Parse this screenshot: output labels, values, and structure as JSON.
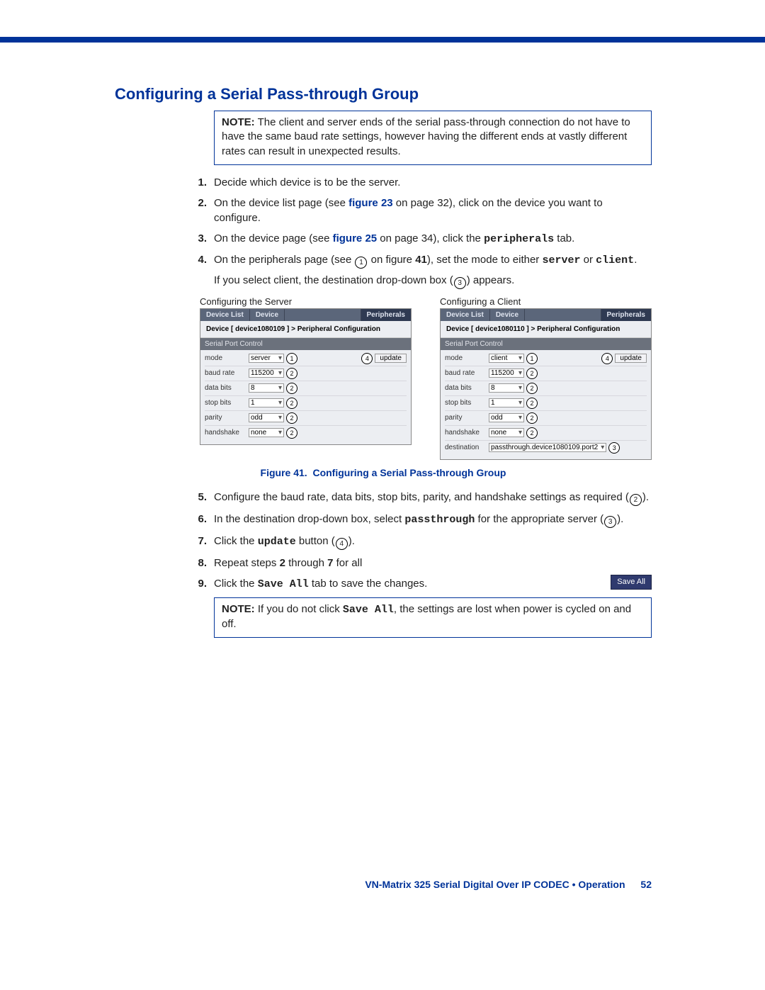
{
  "header": {
    "title": "Configuring a Serial Pass-through Group"
  },
  "note1": {
    "label": "NOTE:",
    "text": "The client and server ends of the serial pass-through connection do not have to have the same baud rate settings, however having the different ends at vastly different rates can result in unexpected results."
  },
  "steps": {
    "s1": {
      "n": "1.",
      "t": "Decide which device is to be the server."
    },
    "s2": {
      "n": "2.",
      "pre": "On the device list page (see ",
      "figref": "figure 23",
      "mid": " on page 32), click on the device you want to configure."
    },
    "s3": {
      "n": "3.",
      "pre": "On the device page (see ",
      "figref": "figure 25",
      "mid": " on page 34), click the ",
      "code": "peripherals",
      "post": " tab."
    },
    "s4": {
      "n": "4.",
      "pre": "On the peripherals page (see ",
      "c1": "①",
      "mid1": " on figure ",
      "fignum": "41",
      "mid2": "), set the mode to either ",
      "code1": "server",
      "or": " or ",
      "code2": "client",
      "dot": "."
    },
    "s4b": {
      "pre": "If you select client, the destination drop-down box (",
      "c": "③",
      "post": ") appears."
    },
    "s5": {
      "n": "5.",
      "pre": "Configure the baud rate, data bits, stop bits, parity, and handshake settings as required (",
      "c": "②",
      "post": ")."
    },
    "s6": {
      "n": "6.",
      "pre": "In the destination drop-down box, select ",
      "code": "passthrough",
      "mid": " for the appropriate server (",
      "c": "③",
      "post": ")."
    },
    "s7": {
      "n": "7.",
      "pre": "Click the ",
      "code": "update",
      "mid": " button (",
      "c": "④",
      "post": ")."
    },
    "s8": {
      "n": "8.",
      "pre": "Repeat steps ",
      "b1": "2",
      "mid": " through ",
      "b2": "7",
      "post": " for all"
    },
    "s9": {
      "n": "9.",
      "pre": "Click the ",
      "code": "Save All",
      "post": " tab to save the changes."
    }
  },
  "shotServerTitle": "Configuring the Server",
  "shotClientTitle": "Configuring a Client",
  "ui": {
    "tabs": {
      "devlist": "Device List",
      "device": "Device",
      "periph": "Peripherals"
    },
    "bc_server": "Device [ device1080109 ]  >  Peripheral Configuration",
    "bc_client": "Device [ device1080110 ]  >  Peripheral Configuration",
    "section": "Serial Port Control",
    "labels": {
      "mode": "mode",
      "baud": "baud rate",
      "databits": "data bits",
      "stopbits": "stop bits",
      "parity": "parity",
      "handshake": "handshake",
      "destination": "destination"
    },
    "server": {
      "mode": "server",
      "baud": "115200",
      "databits": "8",
      "stopbits": "1",
      "parity": "odd",
      "handshake": "none"
    },
    "client": {
      "mode": "client",
      "baud": "115200",
      "databits": "8",
      "stopbits": "1",
      "parity": "odd",
      "handshake": "none",
      "destination": "passthrough.device1080109.port2"
    },
    "update": "update"
  },
  "figcap": {
    "label": "Figure 41.",
    "text": "Configuring a Serial Pass-through Group"
  },
  "saveAllPill": "Save All",
  "note2": {
    "label": "NOTE:",
    "pre": "If you do not click ",
    "code": "Save All",
    "post": ", the settings are lost when power is cycled on and off."
  },
  "footer": {
    "text": "VN-Matrix 325 Serial Digital Over IP CODEC • Operation",
    "page": "52"
  }
}
